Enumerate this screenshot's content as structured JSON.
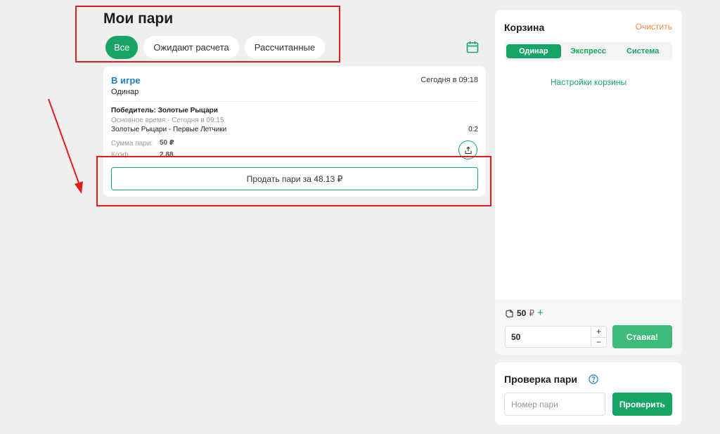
{
  "bets": {
    "title": "Мои пари",
    "filters": [
      {
        "label": "Все",
        "active": true
      },
      {
        "label": "Ожидают расчета",
        "active": false
      },
      {
        "label": "Рассчитанные",
        "active": false
      }
    ],
    "calendar_icon": "calendar-icon",
    "card": {
      "status": "В игре",
      "type": "Одинар",
      "time": "Сегодня в 09:18",
      "winner_label": "Победитель:",
      "winner_value": "Золотые Рыцари",
      "meta": "Основное время · Сегодня в 09:15",
      "match": "Золотые Рыцари - Первые Летчики",
      "score": "0:2",
      "sum_label": "Сумма пари:",
      "sum_value": "50 ₽",
      "coef_label": "Коэф.",
      "coef_value": "2.88",
      "share_icon": "share-icon",
      "sell_label": "Продать пари за 48.13 ₽"
    }
  },
  "cart": {
    "title": "Корзина",
    "clear_label": "Очистить",
    "tabs": [
      {
        "label": "Одинар",
        "active": true
      },
      {
        "label": "Экспресс",
        "active": false
      },
      {
        "label": "Система",
        "active": false
      }
    ],
    "settings_label": "Настройки корзины",
    "stake_value": "50",
    "stake_currency": "₽",
    "stake_plus": "+",
    "input_value": "50",
    "stepper_plus": "+",
    "stepper_minus": "−",
    "bet_button": "Ставка!"
  },
  "check": {
    "title": "Проверка пари",
    "help_icon": "question-circle-icon",
    "input_placeholder": "Номер пари",
    "button_label": "Проверить"
  },
  "colors": {
    "accent": "#17a566",
    "link_blue": "#1b7fc2",
    "clear_orange": "#ef8a4c",
    "annotation_red": "#e01c1c"
  }
}
